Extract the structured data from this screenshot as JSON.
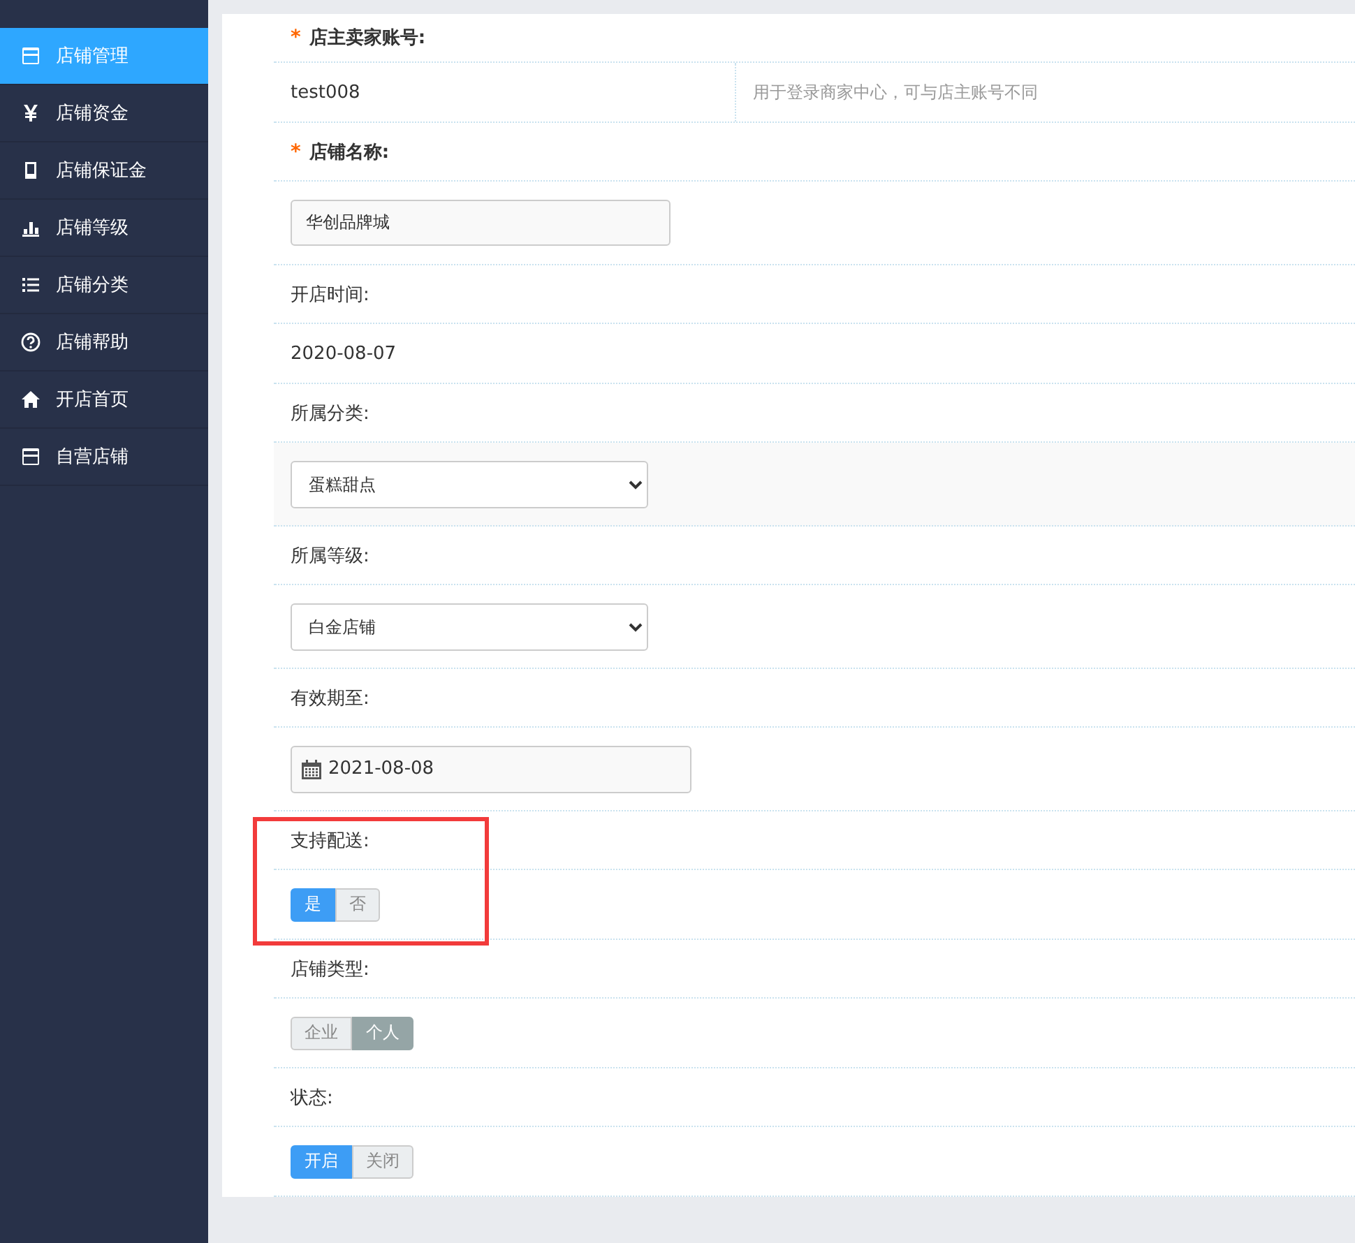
{
  "sidebar": {
    "items": [
      {
        "label": "店铺管理",
        "selected": true
      },
      {
        "label": "店铺资金",
        "selected": false
      },
      {
        "label": "店铺保证金",
        "selected": false
      },
      {
        "label": "店铺等级",
        "selected": false
      },
      {
        "label": "店铺分类",
        "selected": false
      },
      {
        "label": "店铺帮助",
        "selected": false
      },
      {
        "label": "开店首页",
        "selected": false
      },
      {
        "label": "自营店铺",
        "selected": false
      }
    ]
  },
  "form": {
    "fields": [
      {
        "label": "店主卖家账号:",
        "required_mark": "*",
        "kind": "text",
        "value": "test008",
        "hint": "用于登录商家中心，可与店主账号不同",
        "highlighted": false
      },
      {
        "label": "店铺名称:",
        "required_mark": "*",
        "kind": "input",
        "value": "华创品牌城",
        "highlighted": false
      },
      {
        "label": "开店时间:",
        "kind": "text",
        "value": "2020-08-07",
        "highlighted": false
      },
      {
        "label": "所属分类:",
        "kind": "select",
        "value": "蛋糕甜点",
        "highlighted": false
      },
      {
        "label": "所属等级:",
        "kind": "select",
        "value": "白金店铺",
        "highlighted": false
      },
      {
        "label": "有效期至:",
        "kind": "date",
        "value": "2021-08-08",
        "highlighted": false
      },
      {
        "label": "支持配送:",
        "kind": "toggle",
        "options": [
          {
            "label": "是",
            "selected": true
          },
          {
            "label": "否",
            "selected": false
          }
        ],
        "highlighted": true
      },
      {
        "label": "店铺类型:",
        "kind": "toggle",
        "options": [
          {
            "label": "企业",
            "selected": false
          },
          {
            "label": "个人",
            "selected": true
          }
        ],
        "highlighted": false
      },
      {
        "label": "状态:",
        "kind": "toggle",
        "options": [
          {
            "label": "开启",
            "selected": true
          },
          {
            "label": "关闭",
            "selected": false
          }
        ],
        "highlighted": false
      }
    ]
  }
}
